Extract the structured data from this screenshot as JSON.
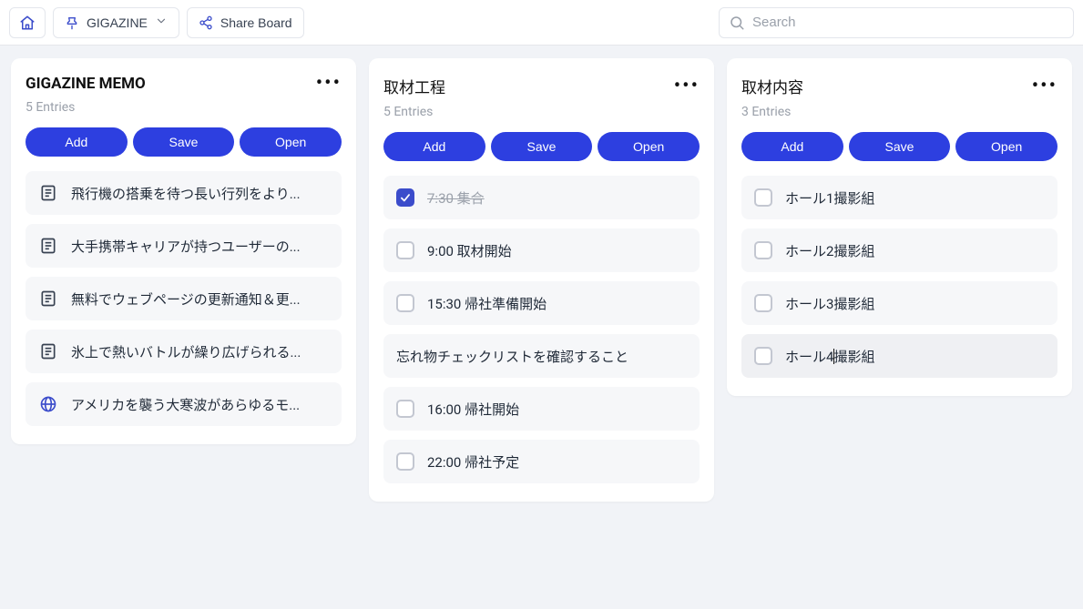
{
  "topbar": {
    "board_name": "GIGAZINE",
    "share_label": "Share Board",
    "search_placeholder": "Search"
  },
  "buttons": {
    "add": "Add",
    "save": "Save",
    "open": "Open"
  },
  "cards": [
    {
      "id": "gigazine-memo",
      "title": "GIGAZINE MEMO",
      "entries_label": "5 Entries",
      "items": [
        {
          "kind": "link",
          "icon": "page",
          "text": "飛行機の搭乗を待つ長い行列をより..."
        },
        {
          "kind": "link",
          "icon": "page",
          "text": "大手携帯キャリアが持つユーザーの..."
        },
        {
          "kind": "link",
          "icon": "page",
          "text": "無料でウェブページの更新通知＆更..."
        },
        {
          "kind": "link",
          "icon": "page",
          "text": "氷上で熱いバトルが繰り広げられる..."
        },
        {
          "kind": "link",
          "icon": "globe",
          "text": "アメリカを襲う大寒波があらゆるモ..."
        }
      ]
    },
    {
      "id": "process",
      "title": "取材工程",
      "entries_label": "5 Entries",
      "items": [
        {
          "kind": "todo",
          "checked": true,
          "text": "7:30 集合"
        },
        {
          "kind": "todo",
          "checked": false,
          "text": "9:00 取材開始"
        },
        {
          "kind": "todo",
          "checked": false,
          "text": "15:30 帰社準備開始"
        },
        {
          "kind": "note",
          "text": "忘れ物チェックリストを確認すること"
        },
        {
          "kind": "todo",
          "checked": false,
          "text": "16:00 帰社開始"
        },
        {
          "kind": "todo",
          "checked": false,
          "text": "22:00 帰社予定"
        }
      ]
    },
    {
      "id": "content",
      "title": "取材内容",
      "entries_label": "3 Entries",
      "items": [
        {
          "kind": "todo",
          "checked": false,
          "text": "ホール1撮影組"
        },
        {
          "kind": "todo",
          "checked": false,
          "text": "ホール2撮影組"
        },
        {
          "kind": "todo",
          "checked": false,
          "text": "ホール3撮影組"
        },
        {
          "kind": "todo-editing",
          "checked": false,
          "prefix": "ホール4",
          "suffix": "撮影組"
        }
      ]
    }
  ]
}
